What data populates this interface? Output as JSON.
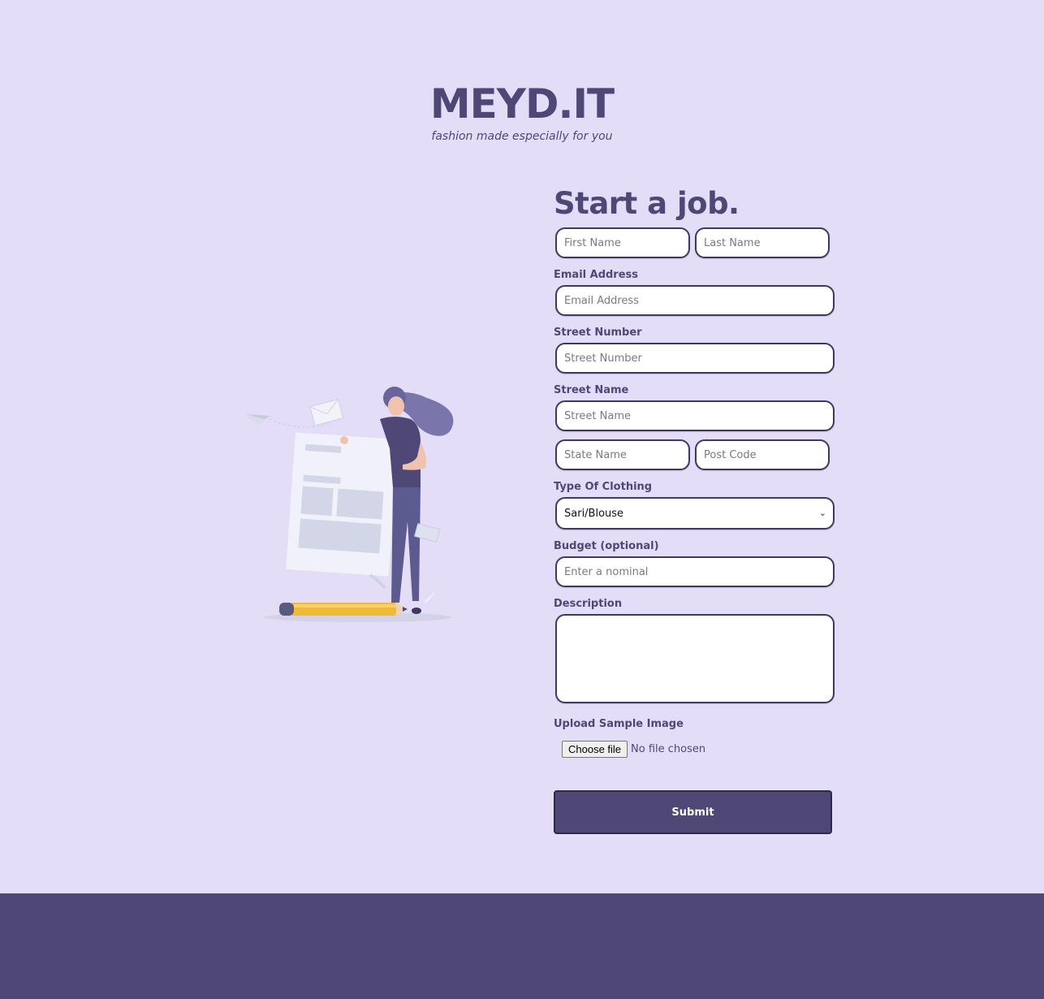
{
  "brand": {
    "title": "MEYD.IT",
    "tagline": "fashion made especially for you"
  },
  "illustration": {
    "icon": "woman-with-document-illustration"
  },
  "form": {
    "heading": "Start a job.",
    "first_name_placeholder": "First Name",
    "last_name_placeholder": "Last Name",
    "email_label": "Email Address",
    "email_placeholder": "Email Address",
    "street_number_label": "Street Number",
    "street_number_placeholder": "Street Number",
    "street_name_label": "Street Name",
    "street_name_placeholder": "Street Name",
    "state_placeholder": "State Name",
    "postcode_placeholder": "Post Code",
    "clothing_label": "Type Of Clothing",
    "clothing_selected": "Sari/Blouse",
    "budget_label": "Budget (optional)",
    "budget_placeholder": "Enter a nominal",
    "description_label": "Description",
    "upload_label": "Upload Sample Image",
    "upload_button": "Choose file",
    "upload_status": "No file chosen",
    "submit_label": "Submit"
  },
  "colors": {
    "background": "#e3ddf7",
    "accent": "#4f4876",
    "footer": "#4f4876"
  }
}
